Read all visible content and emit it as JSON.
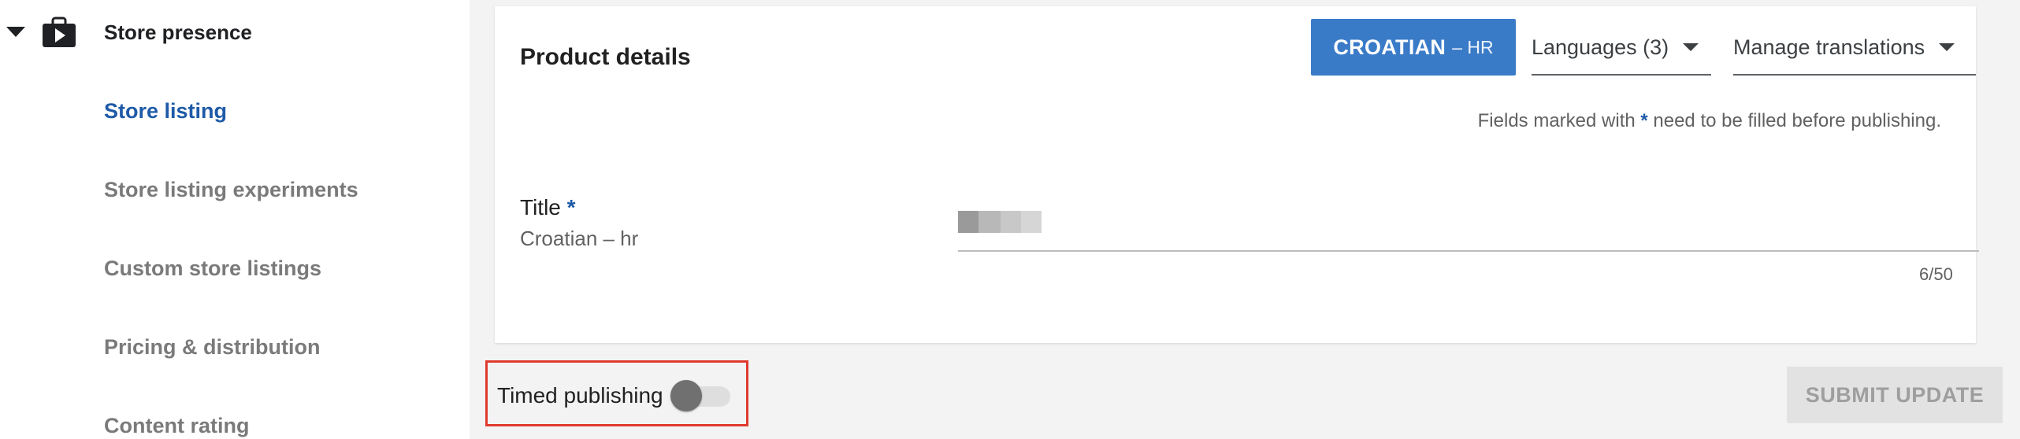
{
  "sidebar": {
    "section": {
      "title": "Store presence",
      "icon": "play-store-bag-icon",
      "caret_icon": "caret-down-icon"
    },
    "items": [
      {
        "label": "Store listing",
        "active": true
      },
      {
        "label": "Store listing experiments",
        "active": false
      },
      {
        "label": "Custom store listings",
        "active": false
      },
      {
        "label": "Pricing & distribution",
        "active": false
      },
      {
        "label": "Content rating",
        "active": false
      }
    ]
  },
  "product_details": {
    "title": "Product details",
    "language_button": {
      "code": "CROATIAN",
      "suffix": "– HR"
    },
    "languages_dropdown": "Languages (3)",
    "manage_translations_dropdown": "Manage translations",
    "fields_note": {
      "before": "Fields marked with",
      "asterisk": "*",
      "after": "need to be filled before publishing."
    },
    "title_field": {
      "label": "Title",
      "required_mark": "*",
      "sublabel": "Croatian – hr",
      "counter": "6/50"
    }
  },
  "footer": {
    "timed_publishing_label": "Timed publishing",
    "timed_publishing_on": false,
    "submit_label": "SUBMIT UPDATE"
  },
  "colors": {
    "accent": "#3a7bc8",
    "active_nav": "#1e5aa8",
    "highlight_border": "#e03a2e"
  }
}
